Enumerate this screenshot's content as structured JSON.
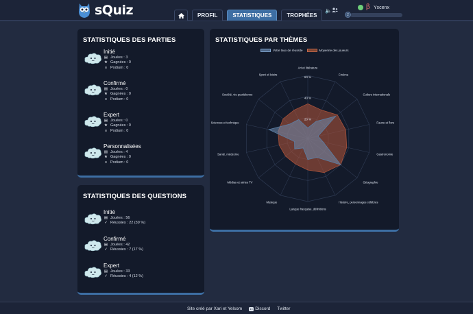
{
  "header": {
    "app_name": "sQuiz",
    "nav": [
      {
        "label": "",
        "icon": "home-icon",
        "active": false
      },
      {
        "label": "PROFIL",
        "active": false
      },
      {
        "label": "STATISTIQUES",
        "active": true
      },
      {
        "label": "TROPHÉES",
        "active": false
      }
    ],
    "user": {
      "name": "Yxcenx",
      "beta_symbol": "β",
      "level": "2",
      "xp_progress": 0
    }
  },
  "parties": {
    "title": "STATISTIQUES DES PARTIES",
    "items": [
      {
        "name": "Initié",
        "lines": [
          "Jouées : 3",
          "Gagnées : 0",
          "Podium : 0"
        ]
      },
      {
        "name": "Confirmé",
        "lines": [
          "Jouées : 0",
          "Gagnées : 0",
          "Podium : 0"
        ]
      },
      {
        "name": "Expert",
        "lines": [
          "Jouées : 0",
          "Gagnées : 0",
          "Podium : 0"
        ]
      },
      {
        "name": "Personnalisées",
        "lines": [
          "Jouées : 4",
          "Gagnées : 0",
          "Podium : 0"
        ]
      }
    ]
  },
  "questions": {
    "title": "STATISTIQUES DES QUESTIONS",
    "items": [
      {
        "name": "Initié",
        "lines": [
          "Jouées : 56",
          "Réussies : 22 (39 %)"
        ]
      },
      {
        "name": "Confirmé",
        "lines": [
          "Jouées : 42",
          "Réussies : 7 (17 %)"
        ]
      },
      {
        "name": "Expert",
        "lines": [
          "Jouées : 33",
          "Réussies : 4 (12 %)"
        ]
      }
    ]
  },
  "themes": {
    "title": "STATISTIQUES PAR THÈMES"
  },
  "chart_data": {
    "type": "radar",
    "categories": [
      "Art et littérature",
      "Cinéma",
      "Culture internationale",
      "Faune et flore",
      "Gastronomie",
      "Géographie",
      "Histoire, personnages célèbres",
      "Langue française, définitions",
      "Musique",
      "Médias et séries TV",
      "Santé, médecine",
      "Sciences et technique",
      "Société, vie quotidienne",
      "Sport et loisirs"
    ],
    "rticks": [
      "60 %",
      "40 %",
      "20 %"
    ],
    "rmax": 60,
    "series": [
      {
        "name": "Votre taux de réussite",
        "color": "#5b7fa6",
        "values": [
          10,
          18,
          34,
          10,
          15,
          40,
          20,
          20,
          10,
          16,
          13,
          38,
          22,
          20
        ]
      },
      {
        "name": "Moyenne des joueurs",
        "color": "#a8523a",
        "values": [
          33,
          30,
          36,
          37,
          38,
          40,
          36,
          30,
          27,
          27,
          28,
          29,
          30,
          30
        ]
      }
    ]
  },
  "footer": {
    "credit": "Site créé par Xari et Yelsom",
    "discord": "Discord",
    "twitter": "Twitter"
  },
  "colors": {
    "accent": "#3d6ea3",
    "background": "#222b40",
    "panel": "#131a2a"
  }
}
